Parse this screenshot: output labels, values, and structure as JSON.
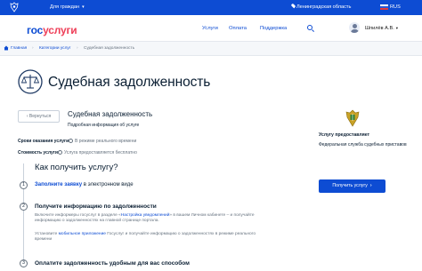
{
  "topbar": {
    "audience": "Для граждан",
    "location": "Ленинградская область",
    "language": "RUS"
  },
  "header": {
    "logo_part1": "гос",
    "logo_part2": "услуги",
    "nav": [
      "Услуги",
      "Оплата",
      "Поддержка"
    ],
    "user_name": "Шпилёв А.В."
  },
  "breadcrumb": [
    "Главная",
    "Категории услуг",
    "Судебная задолженность"
  ],
  "page": {
    "title": "Судебная задолженность"
  },
  "service": {
    "back_label": "Вернуться",
    "title": "Судебная задолженность",
    "subtitle": "Подробная информация об услуге",
    "rows": [
      {
        "label": "Сроки оказания услуги:",
        "value": "В режиме реального времени"
      },
      {
        "label": "Стоимость услуги:",
        "value": "Услуга предоставляется бесплатно"
      }
    ]
  },
  "steps": {
    "heading": "Как получить услугу?",
    "step1_link": "Заполните заявку",
    "step1_rest": "в электронном виде",
    "step2_head": "Получите информацию по задолженности",
    "step2_p1_a": "Включите информеры госуслуг в разделе «",
    "step2_p1_link": "Настройка уведомлений",
    "step2_p1_b": "» в вашем Личном кабинете – и получайте",
    "step2_p1_c": "информацию о задолженностях на главной странице портала.",
    "step2_p2_a": "Установите ",
    "step2_p2_link": "мобильное приложение",
    "step2_p2_b": " Госуслуг и получайте информацию о задолженностях в режиме реального",
    "step2_p2_c": "времени",
    "step3_head": "Оплатите задолженность удобным для вас способом",
    "numbers": [
      "1",
      "2",
      "3"
    ]
  },
  "sidebar": {
    "provider_label": "Услугу предоставляет",
    "provider_value": "Федеральная служба судебных приставов",
    "button_label": "Получить услугу"
  },
  "colors": {
    "brand_blue": "#0d4cd3",
    "brand_red": "#ee3f58",
    "muted": "#66727f"
  }
}
